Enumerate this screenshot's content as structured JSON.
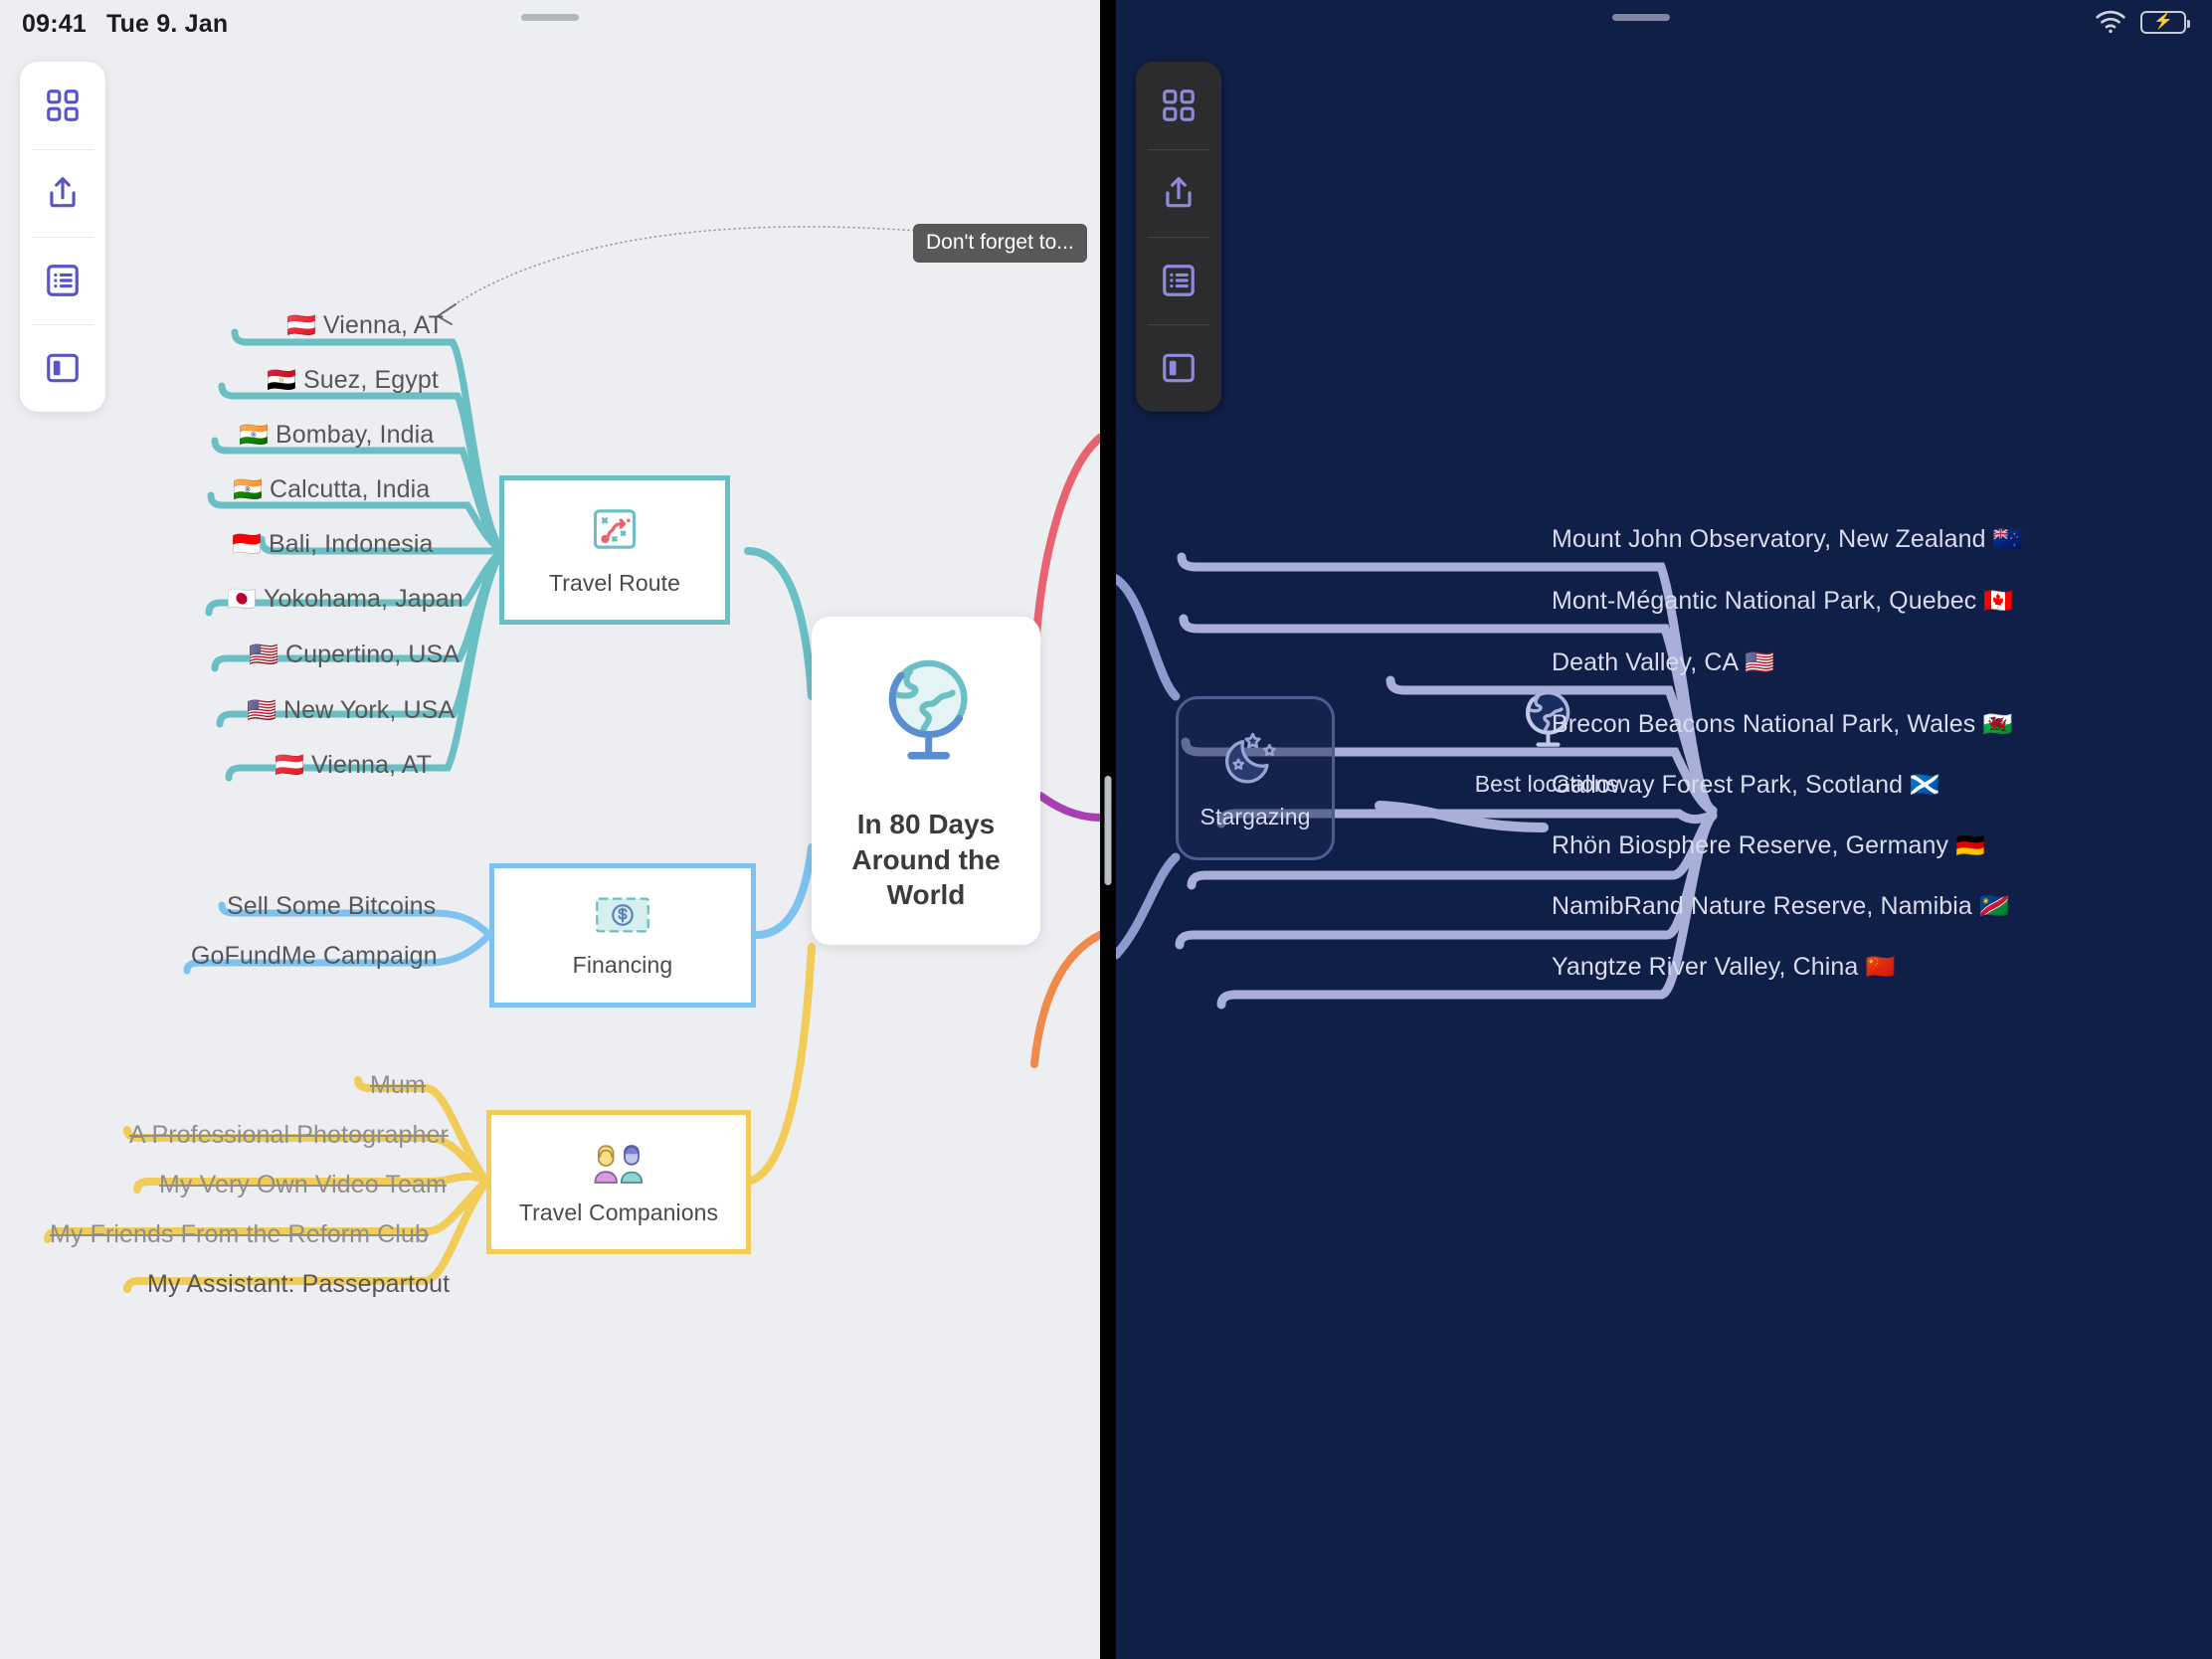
{
  "status_bar": {
    "time": "09:41",
    "date": "Tue 9. Jan",
    "wifi_icon": "wifi-icon",
    "battery_icon": "battery-charging-icon"
  },
  "toolbar": {
    "items": [
      {
        "name": "grid-icon",
        "label": "Overview"
      },
      {
        "name": "share-icon",
        "label": "Share"
      },
      {
        "name": "outline-icon",
        "label": "Outline"
      },
      {
        "name": "sidebar-icon",
        "label": "Sidebar"
      }
    ]
  },
  "left_map": {
    "central": {
      "title": "In 80 Days\nAround the\nWorld",
      "title_lines": [
        "In 80 Days",
        "Around the",
        "World"
      ],
      "icon": "globe-icon"
    },
    "callout": {
      "text": "Don't forget to..."
    },
    "branches": [
      {
        "name": "travel-route",
        "label": "Travel Route",
        "icon": "route-map-icon",
        "color": "#69bfc4",
        "children": [
          {
            "flag": "🇦🇹",
            "text": "Vienna, AT"
          },
          {
            "flag": "🇪🇬",
            "text": "Suez, Egypt"
          },
          {
            "flag": "🇮🇳",
            "text": "Bombay, India"
          },
          {
            "flag": "🇮🇳",
            "text": "Calcutta, India"
          },
          {
            "flag": "🇮🇩",
            "text": "Bali, Indonesia"
          },
          {
            "flag": "🇯🇵",
            "text": "Yokohama, Japan"
          },
          {
            "flag": "🇺🇸",
            "text": "Cupertino, USA"
          },
          {
            "flag": "🇺🇸",
            "text": "New York, USA"
          },
          {
            "flag": "🇦🇹",
            "text": "Vienna, AT"
          }
        ]
      },
      {
        "name": "financing",
        "label": "Financing",
        "icon": "banknote-icon",
        "color": "#7dc2f0",
        "children": [
          {
            "flag": "",
            "text": "Sell Some Bitcoins"
          },
          {
            "flag": "",
            "text": "GoFundMe Campaign"
          }
        ]
      },
      {
        "name": "travel-companions",
        "label": "Travel Companions",
        "icon": "people-icon",
        "color": "#f2cc58",
        "children": [
          {
            "flag": "",
            "text": "Mum",
            "struck": true
          },
          {
            "flag": "",
            "text": "A Professional Photographer",
            "struck": true
          },
          {
            "flag": "",
            "text": "My Very Own Video Team",
            "struck": true
          },
          {
            "flag": "",
            "text": "My Friends From the Reform Club",
            "struck": true
          },
          {
            "flag": "",
            "text": "My Assistant: Passepartout",
            "struck": false
          }
        ]
      }
    ]
  },
  "right_map": {
    "stargazing": {
      "label": "Stargazing",
      "icon": "moon-stars-icon"
    },
    "best_locations": {
      "label": "Best locations",
      "icon": "globe-icon"
    },
    "locations": [
      {
        "text": "Mount John Observatory, New Zealand",
        "flag": "🇳🇿"
      },
      {
        "text": "Mont-Mégantic National Park, Quebec",
        "flag": "🇨🇦"
      },
      {
        "text": "Death Valley, CA",
        "flag": "🇺🇸"
      },
      {
        "text": "Brecon Beacons National Park, Wales",
        "flag": "🏴󠁧󠁢󠁷󠁬󠁳󠁿"
      },
      {
        "text": "Galloway Forest Park, Scotland",
        "flag": "🏴󠁧󠁢󠁳󠁣󠁴󠁿"
      },
      {
        "text": "Rhön Biosphere Reserve, Germany",
        "flag": "🇩🇪"
      },
      {
        "text": "NamibRand Nature Reserve, Namibia",
        "flag": "🇳🇦"
      },
      {
        "text": "Yangtze River Valley, China",
        "flag": "🇨🇳"
      }
    ]
  },
  "colors": {
    "teal": "#69bfc4",
    "blue": "#7dc2f0",
    "yellow": "#f2cc58",
    "red": "#e8636f",
    "purple": "#a83fb0",
    "orange": "#f08a4b",
    "dark_bg": "#101f47",
    "light_bg": "#eceef1",
    "branch_lavender": "#9aa4d4"
  }
}
